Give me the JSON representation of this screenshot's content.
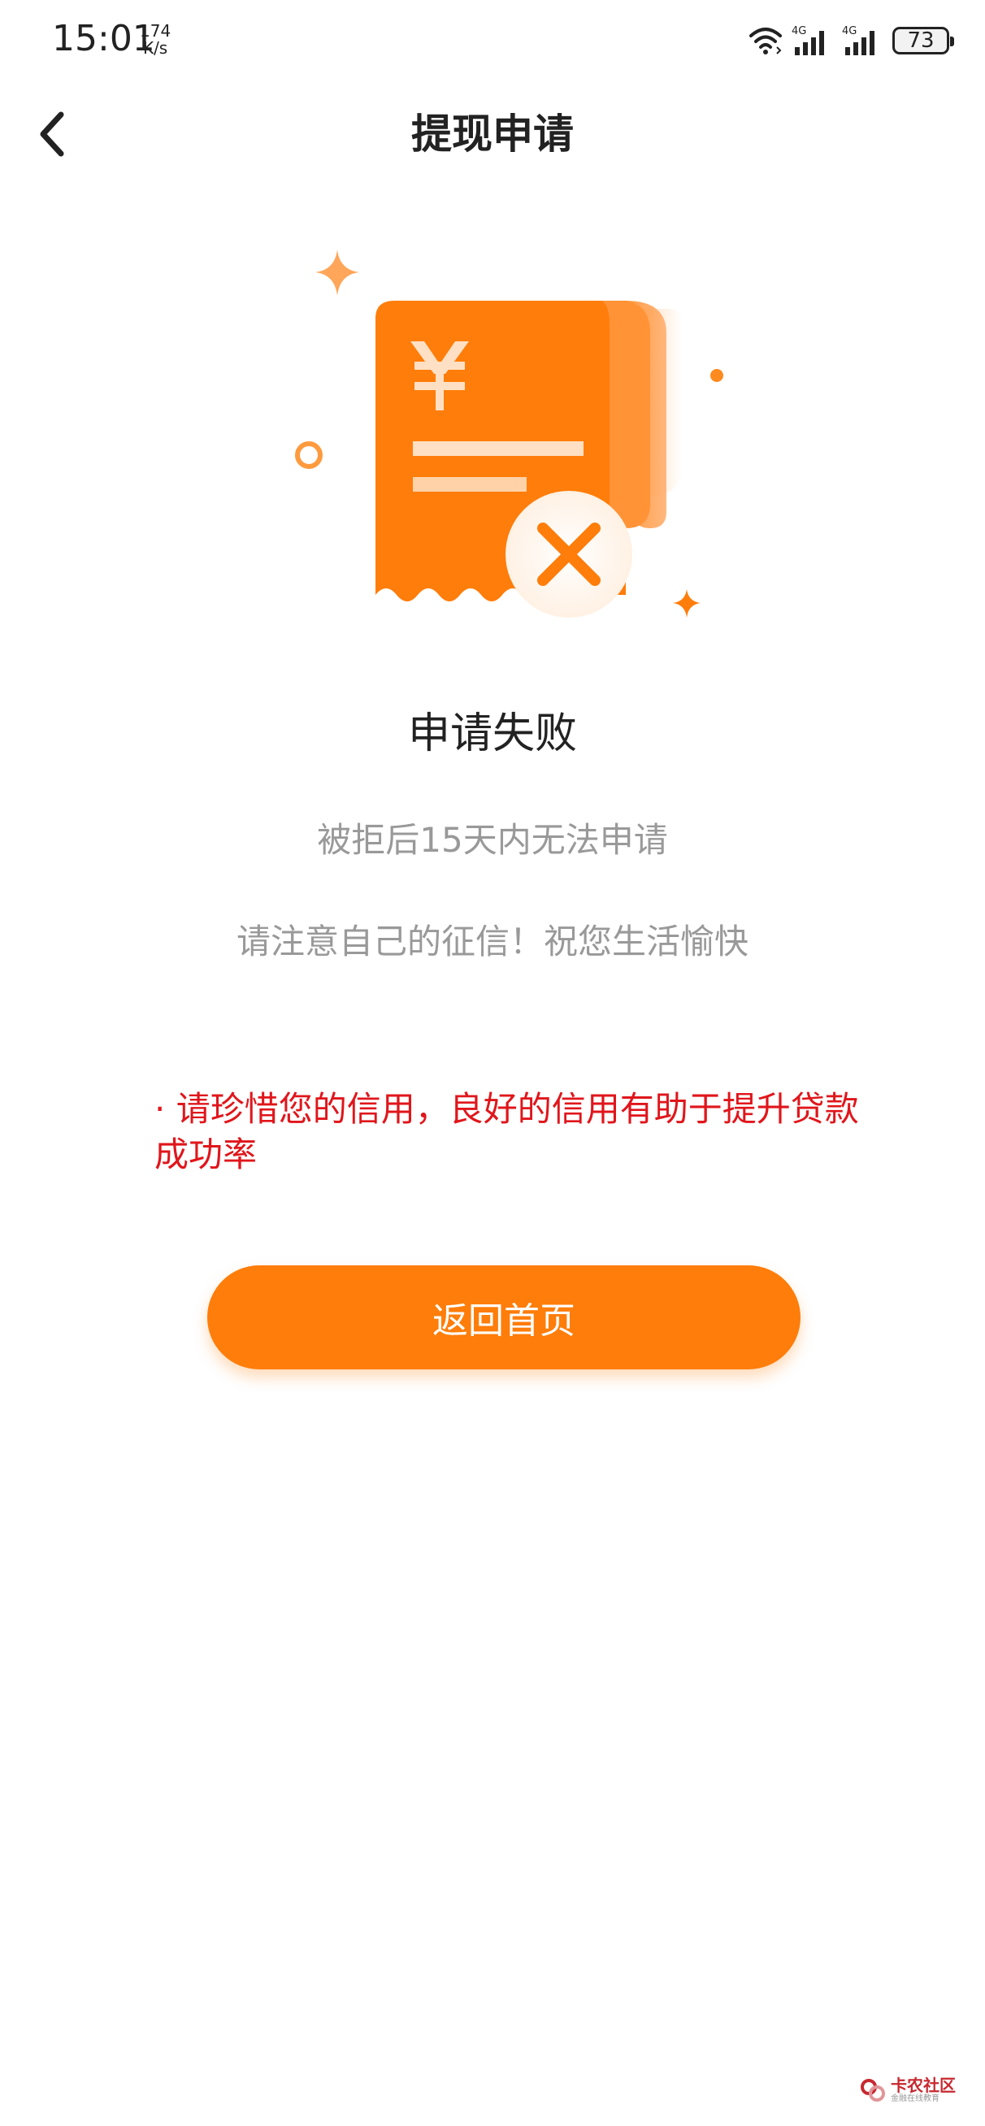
{
  "status_bar": {
    "time": "15:01",
    "net_speed_value": "174",
    "net_speed_unit": "K/s",
    "network_1": "4G",
    "network_2": "4G",
    "battery": "73"
  },
  "nav": {
    "title": "提现申请"
  },
  "result": {
    "title": "申请失败",
    "subtitle": "被拒后15天内无法申请",
    "note": "请注意自己的征信！祝您生活愉快"
  },
  "tip": {
    "text": "· 请珍惜您的信用，良好的信用有助于提升贷款成功率"
  },
  "actions": {
    "home_button": "返回首页"
  },
  "watermark": {
    "title": "卡农社区",
    "subtitle": "金融在线教育"
  },
  "colors": {
    "accent": "#ff7d0a",
    "tip": "#e0161b",
    "secondary_text": "#999999"
  }
}
